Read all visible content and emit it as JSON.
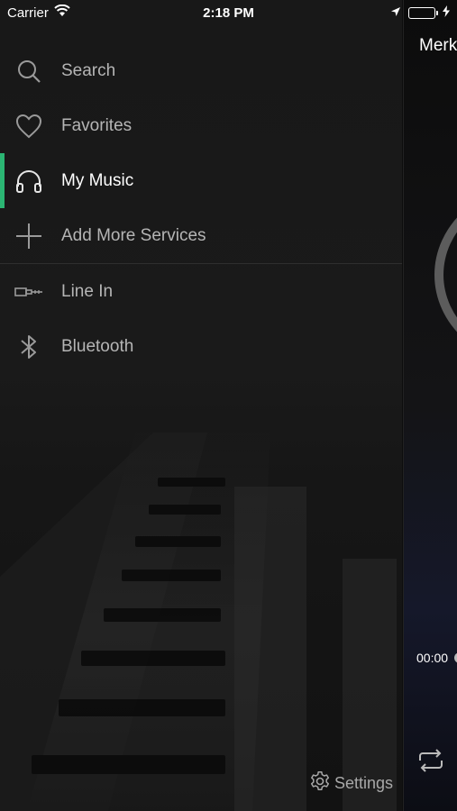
{
  "status_bar": {
    "carrier": "Carrier",
    "time": "2:18 PM"
  },
  "menu": {
    "items": [
      {
        "label": "Search",
        "icon": "search-icon",
        "active": false
      },
      {
        "label": "Favorites",
        "icon": "heart-icon",
        "active": false
      },
      {
        "label": "My Music",
        "icon": "headphones-icon",
        "active": true
      },
      {
        "label": "Add More Services",
        "icon": "plus-icon",
        "active": false
      }
    ],
    "inputs": [
      {
        "label": "Line In",
        "icon": "line-in-icon"
      },
      {
        "label": "Bluetooth",
        "icon": "bluetooth-icon"
      }
    ],
    "settings_label": "Settings"
  },
  "player": {
    "title": "Merk",
    "elapsed": "00:00"
  },
  "colors": {
    "accent": "#2bb573",
    "battery": "#4cd964"
  }
}
